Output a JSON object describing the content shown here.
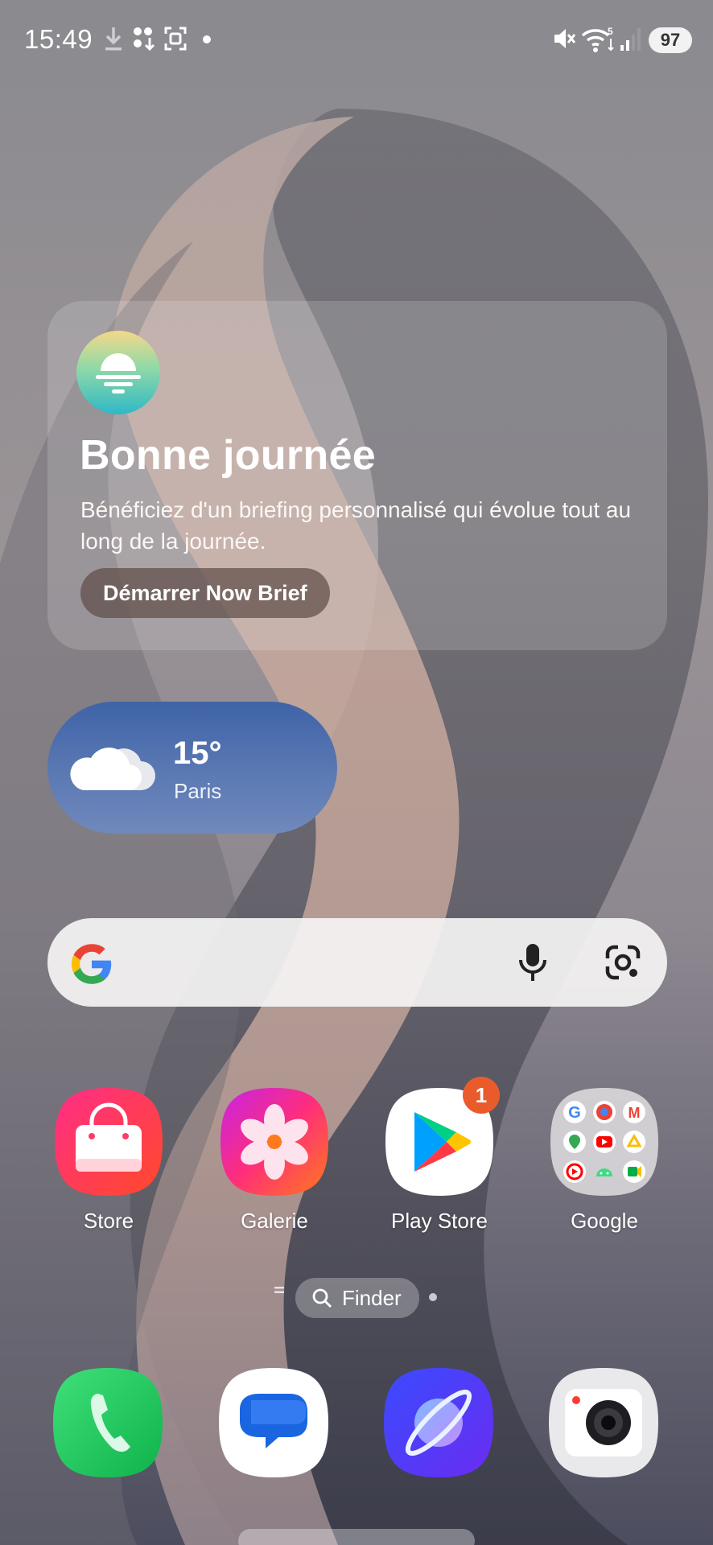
{
  "status_bar": {
    "time": "15:49",
    "battery": "97",
    "icons": [
      "download-icon",
      "sim-transfer-icon",
      "screenshot-icon",
      "dot-icon",
      "mute-icon",
      "wifi-icon",
      "signal-icon",
      "battery-icon"
    ],
    "wifi_label": "5"
  },
  "now_brief": {
    "title": "Bonne journée",
    "text": "Bénéficiez d'un briefing personnalisé qui évolue tout au long de la journée.",
    "button": "Démarrer Now Brief",
    "logo": "sunrise-icon"
  },
  "weather": {
    "temp": "15°",
    "city": "Paris",
    "icon": "cloud-icon"
  },
  "search": {
    "icons": [
      "google-logo-icon",
      "microphone-icon",
      "google-lens-icon"
    ]
  },
  "apps": [
    {
      "label": "Store",
      "icon": "galaxy-store-icon"
    },
    {
      "label": "Galerie",
      "icon": "gallery-icon"
    },
    {
      "label": "Play Store",
      "icon": "play-store-icon",
      "badge": "1"
    },
    {
      "label": "Google",
      "icon": "google-folder-icon"
    }
  ],
  "finder": {
    "label": "Finder",
    "icon": "search-icon"
  },
  "dock": [
    {
      "name": "Téléphone",
      "icon": "phone-icon"
    },
    {
      "name": "Messages",
      "icon": "messages-icon"
    },
    {
      "name": "Internet",
      "icon": "internet-icon"
    },
    {
      "name": "Appareil photo",
      "icon": "camera-icon"
    }
  ],
  "colors": {
    "brief_button": "#5f4e48",
    "weather_top": "#3f63a8",
    "badge": "#ea5b2c",
    "search_bg": "#f4f3f3"
  }
}
